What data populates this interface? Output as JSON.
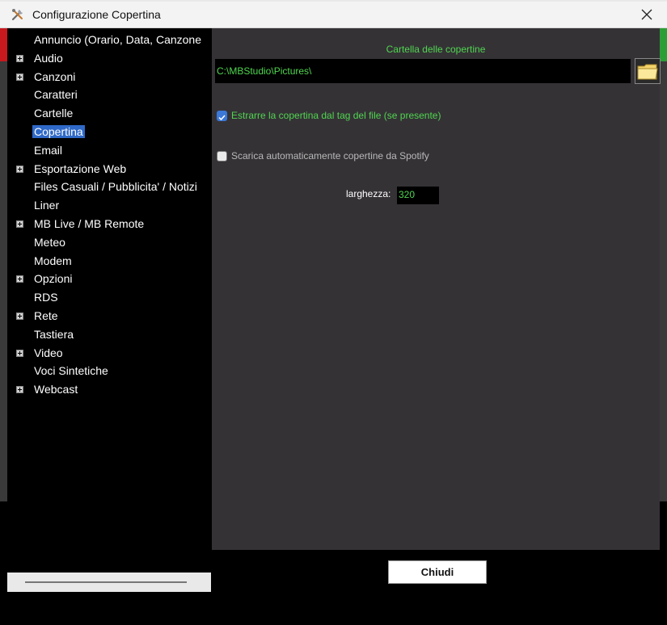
{
  "window": {
    "title": "Configurazione Copertina"
  },
  "tree": {
    "items": [
      {
        "label": "Annuncio (Orario, Data, Canzone",
        "expandable": false,
        "selected": false
      },
      {
        "label": "Audio",
        "expandable": true,
        "selected": false
      },
      {
        "label": "Canzoni",
        "expandable": true,
        "selected": false
      },
      {
        "label": "Caratteri",
        "expandable": false,
        "selected": false
      },
      {
        "label": "Cartelle",
        "expandable": false,
        "selected": false
      },
      {
        "label": "Copertina",
        "expandable": false,
        "selected": true
      },
      {
        "label": "Email",
        "expandable": false,
        "selected": false
      },
      {
        "label": "Esportazione Web",
        "expandable": true,
        "selected": false
      },
      {
        "label": "Files Casuali / Pubblicita' / Notizi",
        "expandable": false,
        "selected": false
      },
      {
        "label": "Liner",
        "expandable": false,
        "selected": false
      },
      {
        "label": "MB Live / MB Remote",
        "expandable": true,
        "selected": false
      },
      {
        "label": "Meteo",
        "expandable": false,
        "selected": false
      },
      {
        "label": "Modem",
        "expandable": false,
        "selected": false
      },
      {
        "label": "Opzioni",
        "expandable": true,
        "selected": false
      },
      {
        "label": "RDS",
        "expandable": false,
        "selected": false
      },
      {
        "label": "Rete",
        "expandable": true,
        "selected": false
      },
      {
        "label": "Tastiera",
        "expandable": false,
        "selected": false
      },
      {
        "label": "Video",
        "expandable": true,
        "selected": false
      },
      {
        "label": "Voci Sintetiche",
        "expandable": false,
        "selected": false
      },
      {
        "label": "Webcast",
        "expandable": true,
        "selected": false
      }
    ]
  },
  "cover": {
    "folder_title": "Cartella delle copertine",
    "folder_path": "C:\\MBStudio\\Pictures\\",
    "folder_icon": "folder-icon",
    "extract_tag_label": "Estrarre la copertina dal tag del file (se presente)",
    "extract_tag_checked": true,
    "spotify_label": "Scarica automaticamente copertine da Spotify",
    "spotify_checked": false,
    "width_label": "larghezza:",
    "width_value": "320"
  },
  "footer": {
    "close_label": "Chiudi"
  },
  "colors": {
    "panel_bg": "#353236",
    "accent_green": "#4fd64f",
    "selection_blue": "#2f69c8"
  }
}
